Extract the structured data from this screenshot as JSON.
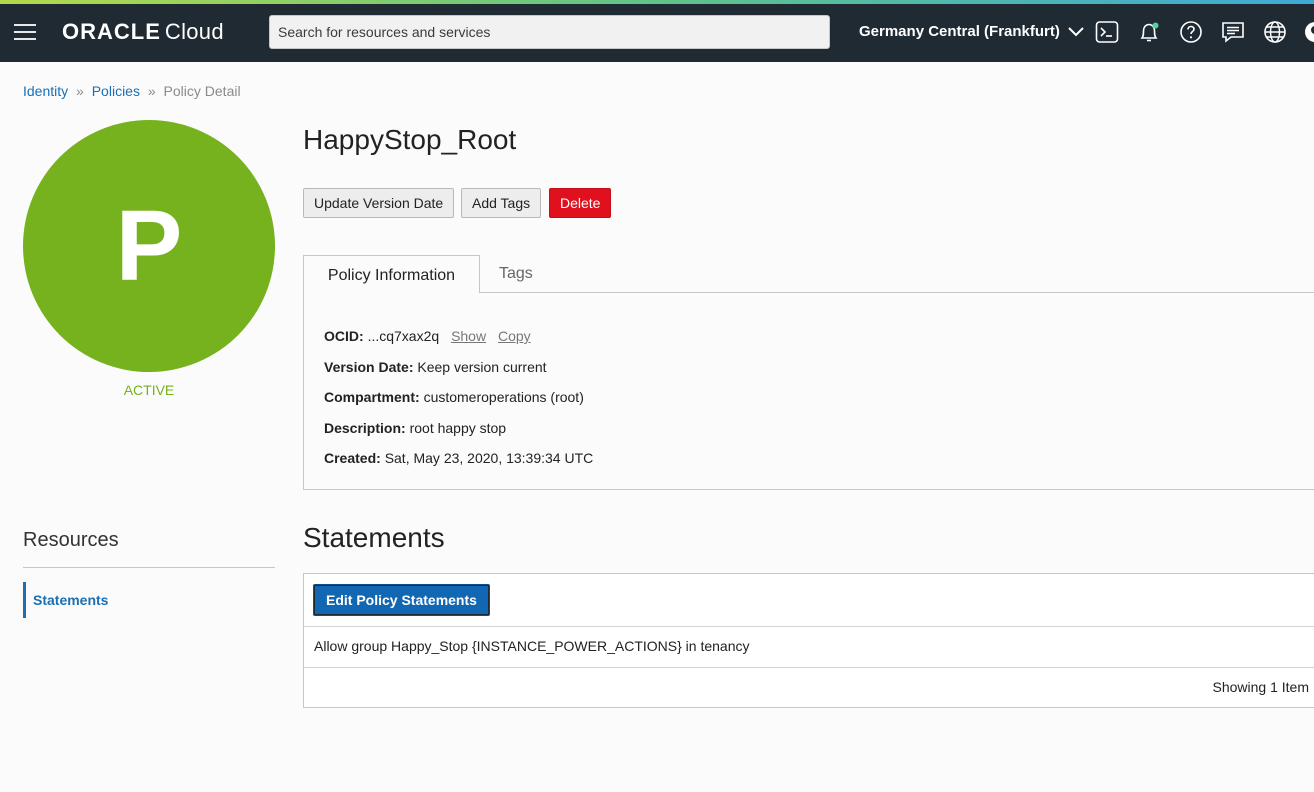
{
  "header": {
    "logo_brand": "ORACLE",
    "logo_product": "Cloud",
    "search_placeholder": "Search for resources and services",
    "region": "Germany Central (Frankfurt)"
  },
  "breadcrumb": {
    "items": [
      "Identity",
      "Policies"
    ],
    "current": "Policy Detail",
    "separator": "»"
  },
  "avatar": {
    "letter": "P",
    "status": "ACTIVE",
    "color": "#76b11e"
  },
  "policy": {
    "name": "HappyStop_Root",
    "actions": {
      "update_version_date": "Update Version Date",
      "add_tags": "Add Tags",
      "delete": "Delete"
    },
    "tabs": {
      "info": "Policy Information",
      "tags": "Tags"
    },
    "info": {
      "ocid_label": "OCID:",
      "ocid_value": "...cq7xax2q",
      "show": "Show",
      "copy": "Copy",
      "version_label": "Version Date:",
      "version_value": "Keep version current",
      "compartment_label": "Compartment:",
      "compartment_value": "customeroperations (root)",
      "description_label": "Description:",
      "description_value": "root happy stop",
      "created_label": "Created:",
      "created_value": "Sat, May 23, 2020, 13:39:34 UTC"
    }
  },
  "resources": {
    "title": "Resources",
    "items": [
      "Statements"
    ]
  },
  "statements": {
    "title": "Statements",
    "edit_button": "Edit Policy Statements",
    "rows": [
      "Allow group Happy_Stop {INSTANCE_POWER_ACTIONS} in tenancy"
    ],
    "footer": "Showing 1 Item"
  },
  "icons": [
    "hamburger-menu-icon",
    "chevron-down-icon",
    "cloud-shell-icon",
    "notifications-bell-icon",
    "help-icon",
    "chat-icon",
    "language-globe-icon"
  ]
}
